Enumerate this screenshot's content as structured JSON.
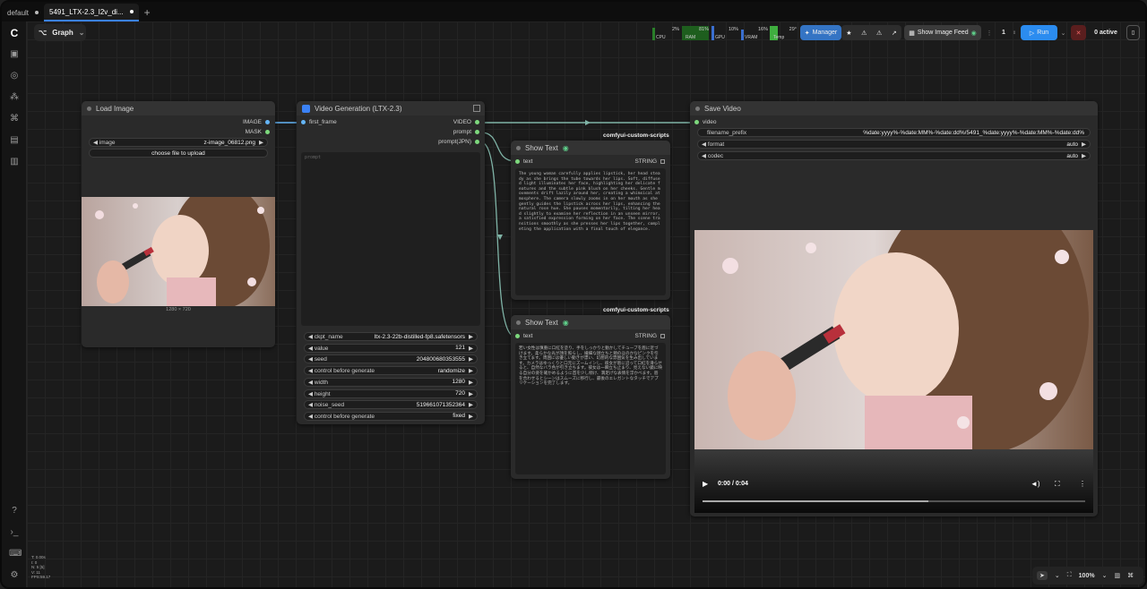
{
  "tabs": [
    {
      "label": "default",
      "active": false
    },
    {
      "label": "5491_LTX-2.3_I2v_di...",
      "active": true
    }
  ],
  "graph_button": {
    "label": "Graph"
  },
  "toolbar": {
    "meters": [
      {
        "label": "CPU",
        "value": "2%"
      },
      {
        "label": "RAM",
        "value": "81%"
      },
      {
        "label": "GPU",
        "value": "10%"
      },
      {
        "label": "VRAM",
        "value": "16%"
      },
      {
        "label": "Temp",
        "value": "29°"
      }
    ],
    "manager_label": "Manager",
    "image_feed_label": "Show Image Feed",
    "queue_count": "1",
    "run_label": "Run",
    "active_label": "0 active"
  },
  "nodes": {
    "load_image": {
      "title": "Load Image",
      "outputs": [
        "IMAGE",
        "MASK"
      ],
      "image_widget_label": "image",
      "image_widget_value": "z-image_06812.png",
      "upload_label": "choose file to upload",
      "dims": "1280 × 720"
    },
    "video_gen": {
      "title": "Video Generation (LTX-2.3)",
      "input": "first_frame",
      "outputs": [
        "VIDEO",
        "prompt",
        "prompt(JPN)"
      ],
      "prompt_placeholder": "prompt",
      "widgets": [
        {
          "label": "ckpt_name",
          "value": "ltx-2.3-22b-distilled-fp8.safetensors"
        },
        {
          "label": "value",
          "value": "121"
        },
        {
          "label": "seed",
          "value": "204800680353555"
        },
        {
          "label": "control before generate",
          "value": "randomize"
        },
        {
          "label": "width",
          "value": "1280"
        },
        {
          "label": "height",
          "value": "720"
        },
        {
          "label": "noise_seed",
          "value": "519661071352364"
        },
        {
          "label": "control before generate",
          "value": "fixed"
        }
      ]
    },
    "show_text_1": {
      "title": "Show Text",
      "tag": "comfyui-custom-scripts",
      "input": "text",
      "output": "STRING",
      "content": "The young woman carefully applies lipstick, her head steady as she brings the tube towards her lips. Soft, diffused light illuminates her face, highlighting her delicate features and the subtle pink blush on her cheeks. Gentle movements drift lazily around her, creating a whimsical atmosphere. The camera slowly zooms in on her mouth as she gently guides the lipstick across her lips, enhancing the natural rose hue. She pauses momentarily, tilting her head slightly to examine her reflection in an unseen mirror, a satisfied expression forming on her face. The scene transitions smoothly as she presses her lips together, completing the application with a final touch of elegance."
    },
    "show_text_2": {
      "title": "Show Text",
      "tag": "comfyui-custom-scripts",
      "input": "text",
      "output": "STRING",
      "content": "若い女性は慎重に口紅を塗り、手をしっかりと動かしてチューブを唇に近づけます。柔らかな光が顔を照らし、繊細な顔立ちと頬のほのかなピンクを引き立てます。周囲には優しい動きが漂い、幻想的な雰囲気を生み出しています。カメラはゆっくりと口元にズームインし、彼女が唇に沿って口紅を滑らせると、自然なバラ色が引き立ちます。彼女は一瞬立ち止まり、見えない鏡に映る自分の姿を確かめるように首を少し傾け、満足げな表情を浮かべます。唇を合わせるとシーンはスムーズに移行し、最後のエレガントなタッチでアプリケーションを完了します。"
    },
    "save_video": {
      "title": "Save Video",
      "input": "video",
      "widgets": [
        {
          "label": "filename_prefix",
          "value": "%date:yyyy%-%date:MM%-%date:dd%/5491_%date:yyyy%-%date:MM%-%date:dd%"
        },
        {
          "label": "format",
          "value": "auto"
        },
        {
          "label": "codec",
          "value": "auto"
        }
      ],
      "time": "0:00 / 0:04"
    }
  },
  "stats": [
    "T: 0.00s",
    "I: 0",
    "N: 5 [5]",
    "V: 11",
    "FPS:59.17"
  ],
  "zoom": "100%",
  "colors": {
    "accent": "#3b82f6",
    "link_video": "#7fb3a6",
    "link_image": "#64b5f6",
    "pin_green": "#7dd87d",
    "run": "#2b8cf0",
    "manager": "#3474c4"
  }
}
